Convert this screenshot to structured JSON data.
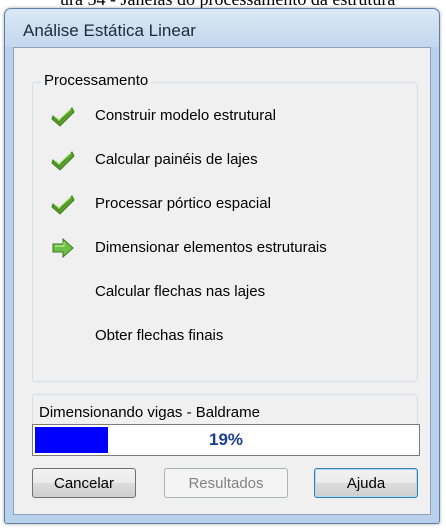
{
  "caption": {
    "text": "ura 54 - Janelas do processamento da estrutura"
  },
  "window": {
    "title": "Análise Estática Linear"
  },
  "processing": {
    "group_title": "Processamento",
    "steps": [
      {
        "label": "Construir modelo estrutural",
        "status": "done",
        "icon": "green-check-icon"
      },
      {
        "label": "Calcular painéis de lajes",
        "status": "done",
        "icon": "green-check-icon"
      },
      {
        "label": "Processar pórtico espacial",
        "status": "done",
        "icon": "green-check-icon"
      },
      {
        "label": "Dimensionar elementos estruturais",
        "status": "current",
        "icon": "green-arrow-icon"
      },
      {
        "label": "Calcular flechas nas lajes",
        "status": "pending",
        "icon": ""
      },
      {
        "label": "Obter flechas finais",
        "status": "pending",
        "icon": ""
      }
    ]
  },
  "status": {
    "text": "Dimensionando vigas - Baldrame"
  },
  "progress": {
    "value": 0.19,
    "label": "19%",
    "fill_color": "#0000ff"
  },
  "buttons": {
    "cancel": "Cancelar",
    "results": "Resultados",
    "help": "Ajuda"
  },
  "colors": {
    "check_green": "#5aa02c",
    "arrow_green": "#6cc04a"
  }
}
